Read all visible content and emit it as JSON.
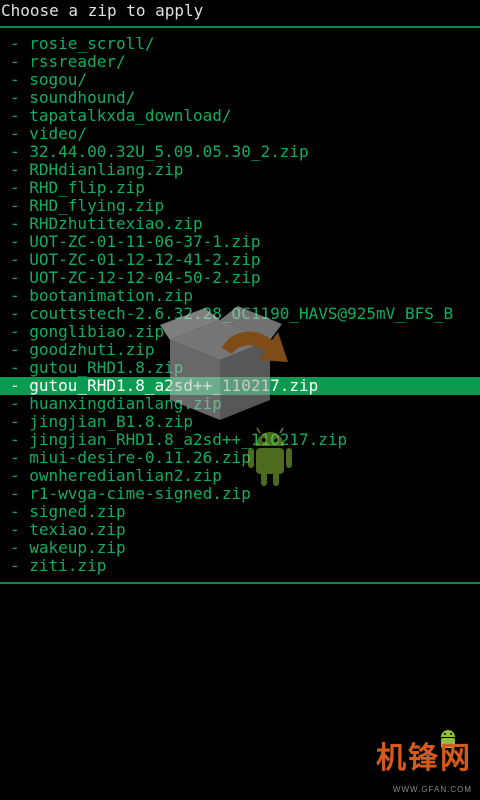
{
  "header": {
    "title": "Choose a zip to apply"
  },
  "colors": {
    "background": "#000000",
    "item_text": "#0fae5f",
    "selection": "#0b9b50",
    "title_text": "#e0e0e0",
    "rule": "#0b8a4a"
  },
  "file_list": {
    "selected_index": 19,
    "items": [
      "- rosie_scroll/",
      "- rssreader/",
      "- sogou/",
      "- soundhound/",
      "- tapatalkxda_download/",
      "- video/",
      "- 32.44.00.32U_5.09.05.30_2.zip",
      "- RDHdianliang.zip",
      "- RHD_flip.zip",
      "- RHD_flying.zip",
      "- RHDzhutitexiao.zip",
      "- UOT-ZC-01-11-06-37-1.zip",
      "- UOT-ZC-01-12-12-41-2.zip",
      "- UOT-ZC-12-12-04-50-2.zip",
      "- bootanimation.zip",
      "- couttstech-2.6.32.28_OC1190_HAVS@925mV_BFS_B",
      "- gonglibiao.zip",
      "- goodzhuti.zip",
      "- gutou_RHD1.8.zip",
      "- gutou_RHD1.8_a2sd++_110217.zip",
      "- huanxingdianlang.zip",
      "- jingjian_B1.8.zip",
      "- jingjian_RHD1.8_a2sd++_110217.zip",
      "- miui-desire-0.11.26.zip",
      "- ownheredianlian2.zip",
      "- r1-wvga-cime-signed.zip",
      "- signed.zip",
      "- texiao.zip",
      "- wakeup.zip",
      "- ziti.zip"
    ]
  },
  "icons": {
    "install_graphic": "package-install-icon",
    "android_robot": "android-robot-icon"
  },
  "watermark": {
    "logo": "机锋网",
    "url": "WWW.GFAN.COM"
  }
}
